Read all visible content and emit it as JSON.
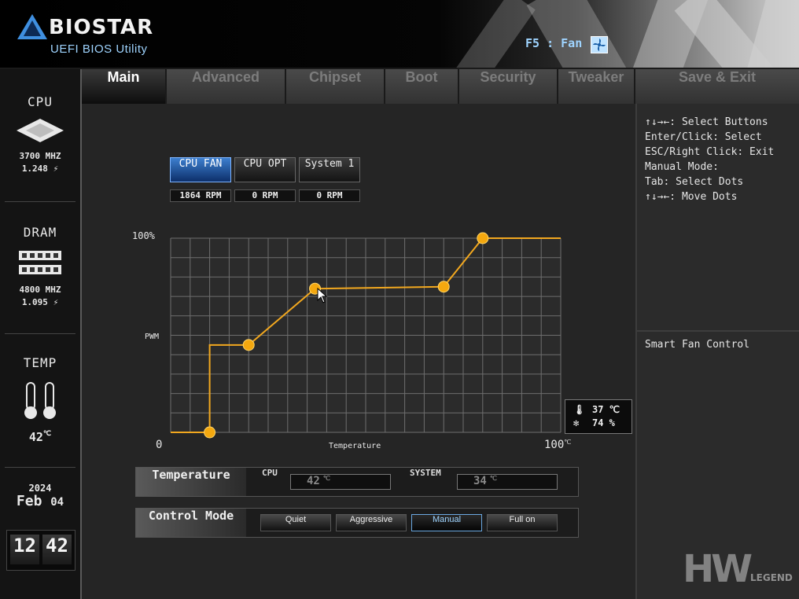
{
  "header": {
    "brand": "BIOSTAR",
    "subtitle": "UEFI BIOS Utility",
    "fkey_hint": "F5 : Fan"
  },
  "sidebar": {
    "cpu": {
      "title": "CPU",
      "freq": "3700 MHZ",
      "volt": "1.248"
    },
    "dram": {
      "title": "DRAM",
      "freq": "4800 MHZ",
      "volt": "1.095"
    },
    "temp": {
      "title": "TEMP",
      "value": "42"
    },
    "date": {
      "year": "2024",
      "month": "Feb",
      "day": "04"
    },
    "clock": {
      "hour": "12",
      "minute": "42"
    }
  },
  "tabs": [
    "Main",
    "Advanced",
    "Chipset",
    "Boot",
    "Security",
    "Tweaker",
    "Save & Exit"
  ],
  "fans": [
    {
      "label": "CPU FAN",
      "rpm": "1864 RPM",
      "selected": true
    },
    {
      "label": "CPU OPT",
      "rpm": "0 RPM",
      "selected": false
    },
    {
      "label": "System 1",
      "rpm": "0 RPM",
      "selected": false
    }
  ],
  "chart_data": {
    "type": "line",
    "y_top_label": "100%",
    "ylabel": "PWM",
    "xlabel": "Temperature",
    "x_min_label": "0",
    "x_max_label": "100",
    "xlim": [
      0,
      100
    ],
    "ylim": [
      0,
      100
    ],
    "grid": true,
    "line_color": "#f2a81f",
    "points": [
      {
        "x": 10,
        "y": 0
      },
      {
        "x": 20,
        "y": 45
      },
      {
        "x": 37,
        "y": 74
      },
      {
        "x": 70,
        "y": 75
      },
      {
        "x": 80,
        "y": 100
      }
    ]
  },
  "tooltip": {
    "temp": "37 ℃",
    "duty": "74 %"
  },
  "temperature_row": {
    "label": "Temperature",
    "cpu_label": "CPU",
    "cpu_value": "42",
    "system_label": "SYSTEM",
    "system_value": "34"
  },
  "control_mode": {
    "label": "Control Mode",
    "options": [
      "Quiet",
      "Aggressive",
      "Manual",
      "Full on"
    ],
    "selected": "Manual"
  },
  "help": {
    "lines": [
      "↑↓→←: Select Buttons",
      "Enter/Click: Select",
      "ESC/Right Click: Exit",
      "Manual Mode:",
      "Tab: Select Dots",
      "↑↓→←: Move Dots"
    ],
    "description": "Smart Fan Control"
  },
  "watermark": {
    "mark": "HW",
    "word": "LEGEND"
  }
}
